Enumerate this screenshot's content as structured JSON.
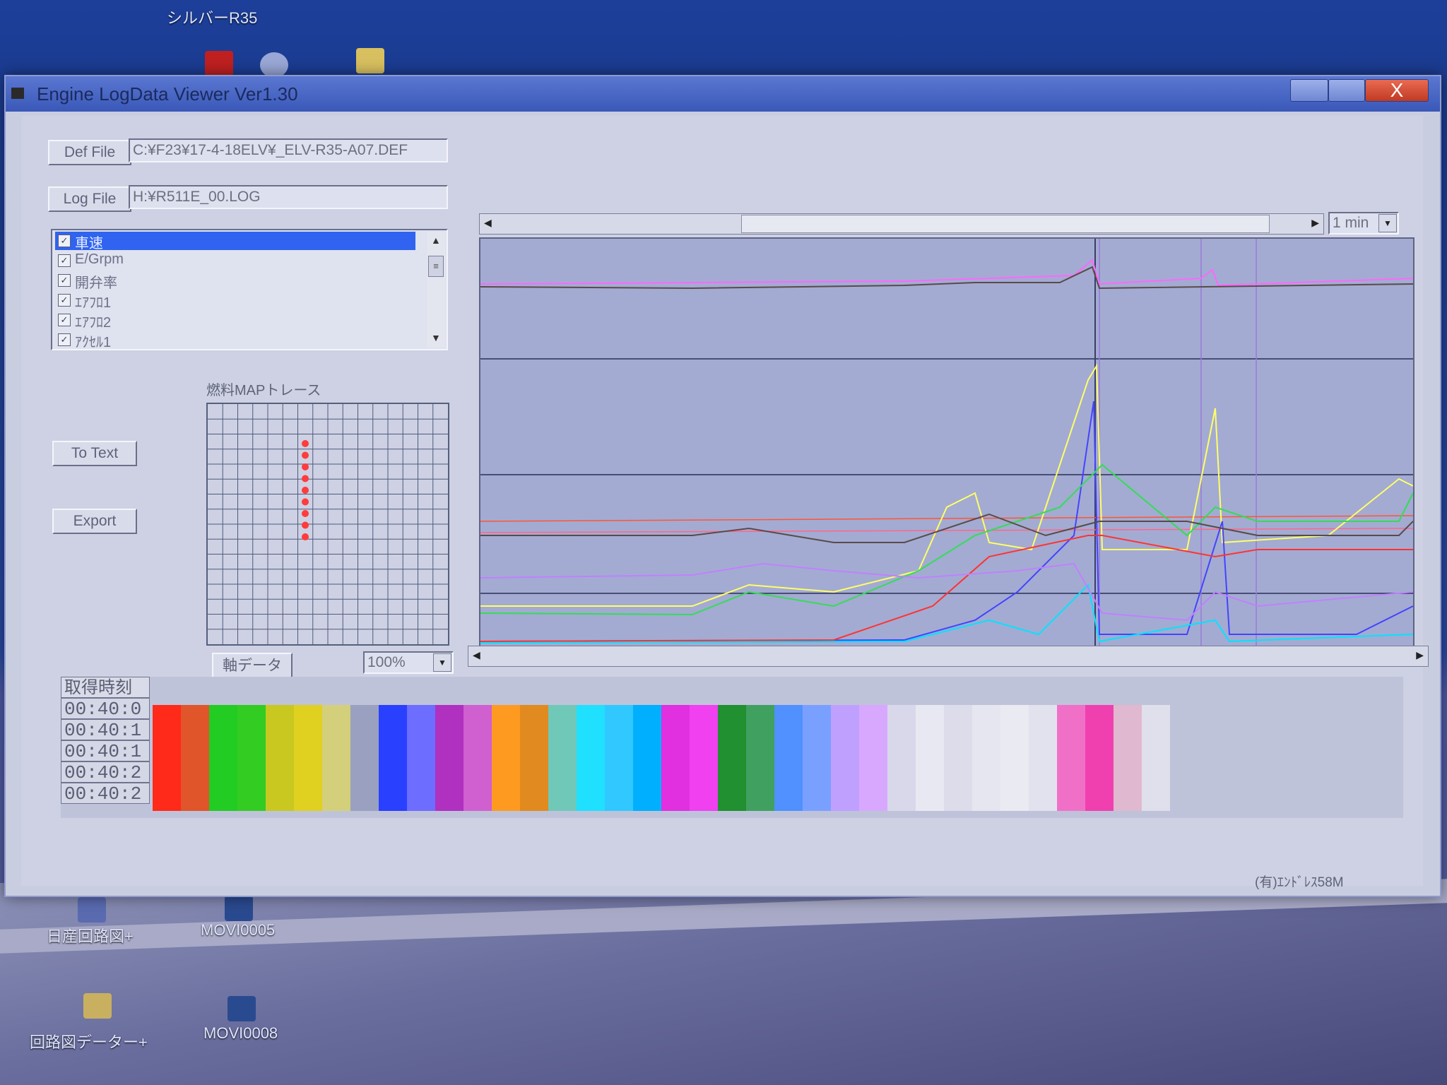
{
  "desktop": {
    "top_label": "シルバーR35",
    "icons": [
      {
        "label": "日産回路図+"
      },
      {
        "label": "MOVI0005"
      },
      {
        "label": "回路図データー+"
      },
      {
        "label": "MOVI0008"
      }
    ]
  },
  "window": {
    "title": "Engine LogData Viewer Ver1.30",
    "close_glyph": "X"
  },
  "files": {
    "def_button": "Def File",
    "def_path": "C:¥F23¥17-4-18ELV¥_ELV-R35-A07.DEF",
    "log_button": "Log File",
    "log_path": "H:¥R511E_00.LOG"
  },
  "channel_list": {
    "items": [
      {
        "label": "車速",
        "checked": true,
        "selected": true
      },
      {
        "label": "E/Grpm",
        "checked": true,
        "selected": false
      },
      {
        "label": "開弁率",
        "checked": true,
        "selected": false
      },
      {
        "label": "ｴｱﾌﾛ1",
        "checked": true,
        "selected": false
      },
      {
        "label": "ｴｱﾌﾛ2",
        "checked": true,
        "selected": false
      },
      {
        "label": "ｱｸｾﾙ1",
        "checked": true,
        "selected": false
      }
    ],
    "check_glyph": "✓"
  },
  "buttons": {
    "to_text": "To Text",
    "export": "Export",
    "axis_data": "軸データ"
  },
  "fuel_map": {
    "label": "燃料MAPトレース",
    "trace_color": "#ff3b3b",
    "grid_color": "#4f5b7d"
  },
  "zoom": {
    "value": "100%"
  },
  "time_range": {
    "value": "1 min"
  },
  "graph": {
    "background": "#a3abd2",
    "scroll_fraction": 0.35,
    "series_colors": [
      "#ff66ff",
      "#ffff66",
      "#4444ff",
      "#33dd55",
      "#ff3333",
      "#00e5ff",
      "#c080ff",
      "#ffffff",
      "#5a4a4a"
    ]
  },
  "data_table": {
    "header": "取得時刻",
    "times": [
      "00:40:0",
      "00:40:1",
      "00:40:1",
      "00:40:2",
      "00:40:2"
    ],
    "column_colors": [
      "#ff2a1a",
      "#e0552a",
      "#22cc22",
      "#33cc22",
      "#c8c820",
      "#e0d020",
      "#d4cf7a",
      "#9aa0c0",
      "#2a40ff",
      "#6d6dff",
      "#b030c0",
      "#d060d0",
      "#ff9a20",
      "#e08a20",
      "#70c8b8",
      "#20e0ff",
      "#30c8ff",
      "#00b0ff",
      "#e030e0",
      "#f040f0",
      "#209030",
      "#40a060",
      "#5090ff",
      "#7aa0ff",
      "#c0a0ff",
      "#d8a8ff",
      "#d8d8ea",
      "#e8e8f2",
      "#dcdcea",
      "#e6e6f0",
      "#eaeaf2",
      "#e2e2ee",
      "#f070c8",
      "#f040b0",
      "#e0b8d0",
      "#e0e0ec"
    ]
  },
  "status": {
    "text": "(有)ｴﾝﾄﾞﾚｽ58M"
  }
}
